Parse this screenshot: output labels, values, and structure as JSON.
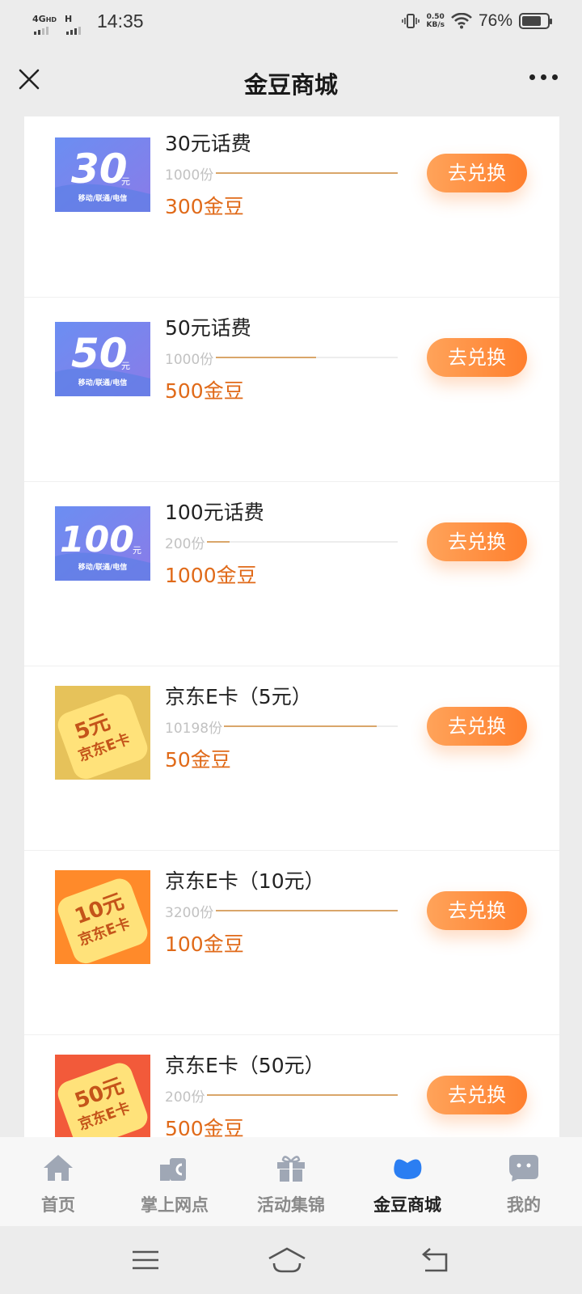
{
  "status_bar": {
    "network": "4G",
    "network_sub": "HD",
    "network2": "H",
    "time": "14:35",
    "speed_value": "0.50",
    "speed_unit": "KB/s",
    "battery": "76%"
  },
  "header": {
    "title": "金豆商城"
  },
  "items": [
    {
      "name": "30元话费",
      "stock": "1000份",
      "progress": 1.0,
      "price": "300金豆",
      "button": "去兑换",
      "thumb_value": "30",
      "thumb_unit": "元",
      "thumb_sub": "移动/联通/电信",
      "thumb_kind": "phone"
    },
    {
      "name": "50元话费",
      "stock": "1000份",
      "progress": 0.55,
      "price": "500金豆",
      "button": "去兑换",
      "thumb_value": "50",
      "thumb_unit": "元",
      "thumb_sub": "移动/联通/电信",
      "thumb_kind": "phone"
    },
    {
      "name": "100元话费",
      "stock": "200份",
      "progress": 0.12,
      "price": "1000金豆",
      "button": "去兑换",
      "thumb_value": "100",
      "thumb_unit": "元",
      "thumb_sub": "移动/联通/电信",
      "thumb_kind": "phone"
    },
    {
      "name": "京东E卡（5元）",
      "stock": "10198份",
      "progress": 0.88,
      "price": "50金豆",
      "button": "去兑换",
      "thumb_value": "5元",
      "thumb_sub": "京东E卡",
      "thumb_kind": "jd",
      "thumb_bg": "#e6c25a"
    },
    {
      "name": "京东E卡（10元）",
      "stock": "3200份",
      "progress": 1.0,
      "price": "100金豆",
      "button": "去兑换",
      "thumb_value": "10元",
      "thumb_sub": "京东E卡",
      "thumb_kind": "jd",
      "thumb_bg": "#ff8a2a"
    },
    {
      "name": "京东E卡（50元）",
      "stock": "200份",
      "progress": 1.0,
      "price": "500金豆",
      "button": "去兑换",
      "thumb_value": "50元",
      "thumb_sub": "京东E卡",
      "thumb_kind": "jd",
      "thumb_bg": "#f25a3a"
    }
  ],
  "tabs": [
    {
      "label": "首页",
      "icon": "home-icon",
      "active": false
    },
    {
      "label": "掌上网点",
      "icon": "branch-icon",
      "active": false
    },
    {
      "label": "活动集锦",
      "icon": "gift-icon",
      "active": false
    },
    {
      "label": "金豆商城",
      "icon": "bean-icon",
      "active": true
    },
    {
      "label": "我的",
      "icon": "profile-icon",
      "active": false
    }
  ],
  "colors": {
    "accent": "#ff8a3d",
    "price": "#e06a19",
    "active_tab_icon": "#2b7ef2",
    "inactive_tab_icon": "#9fa7b5"
  }
}
